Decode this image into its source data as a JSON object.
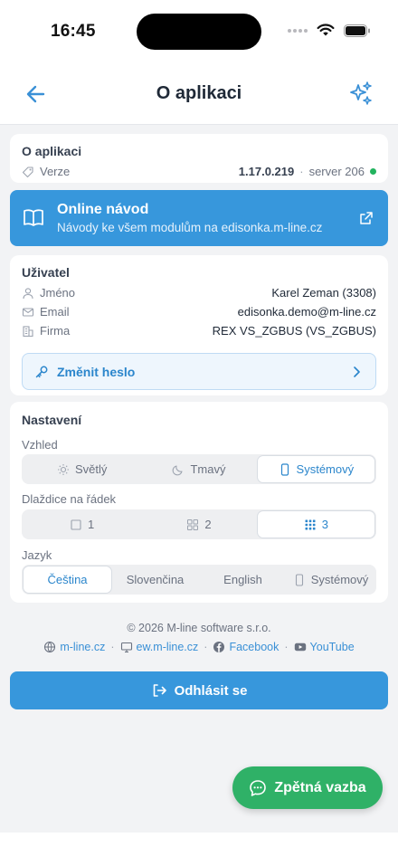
{
  "status_bar": {
    "time": "16:45"
  },
  "nav": {
    "title": "O aplikaci"
  },
  "about": {
    "title": "O aplikaci",
    "version_label": "Verze",
    "version": "1.17.0.219",
    "separator": "·",
    "server": "server 206",
    "server_status_color": "#22b35e"
  },
  "online_guide": {
    "title": "Online návod",
    "subtitle": "Návody ke všem modulům na edisonka.m-line.cz"
  },
  "user": {
    "title": "Uživatel",
    "rows": [
      {
        "label": "Jméno",
        "value": "Karel Zeman (3308)",
        "icon": "user-icon"
      },
      {
        "label": "Email",
        "value": "edisonka.demo@m-line.cz",
        "icon": "mail-icon"
      },
      {
        "label": "Firma",
        "value": "REX VS_ZGBUS (VS_ZGBUS)",
        "icon": "building-icon"
      }
    ],
    "change_password": "Změnit heslo"
  },
  "settings": {
    "title": "Nastavení",
    "appearance_label": "Vzhled",
    "appearance_options": [
      "Světlý",
      "Tmavý",
      "Systémový"
    ],
    "appearance_selected": "Systémový",
    "tiles_label": "Dlaždice na řádek",
    "tiles_options": [
      "1",
      "2",
      "3"
    ],
    "tiles_selected": "3",
    "language_label": "Jazyk",
    "language_options": [
      "Čeština",
      "Slovenčina",
      "English",
      "Systémový"
    ],
    "language_selected": "Čeština"
  },
  "footer": {
    "copyright": "© 2026 M-line software s.r.o.",
    "links": [
      "m-line.cz",
      "ew.m-line.cz",
      "Facebook",
      "YouTube"
    ],
    "separator": "·"
  },
  "logout": "Odhlásit se",
  "feedback": "Zpětná vazba",
  "colors": {
    "accent": "#3797dc",
    "feedback": "#2fb167"
  }
}
